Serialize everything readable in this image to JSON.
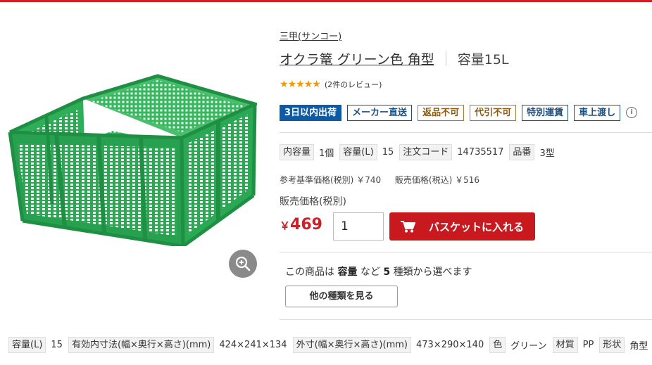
{
  "brand": "三甲(サンコー)",
  "title": "オクラ篭 グリーン色 角型",
  "capacity_heading": "容量15L",
  "rating": {
    "stars": 5,
    "review_text": "(2件のレビュー)"
  },
  "badges": [
    "3日以内出荷",
    "メーカー直送",
    "返品不可",
    "代引不可",
    "特別運賃",
    "車上渡し"
  ],
  "spec_main": [
    {
      "label": "内容量",
      "value": "1個"
    },
    {
      "label": "容量(L)",
      "value": "15"
    },
    {
      "label": "注文コード",
      "value": "14735517"
    },
    {
      "label": "品番",
      "value": "3型"
    }
  ],
  "price": {
    "reference": "参考基準価格(税別) ￥740",
    "incl_tax": "販売価格(税込) ￥516",
    "sale_label": "販売価格(税別)",
    "currency": "￥",
    "amount": "469",
    "quantity": "1",
    "cart_label": "バスケットに入れる"
  },
  "variants": {
    "prefix": "この商品は",
    "attribute": "容量",
    "middle": "など",
    "count": "5",
    "suffix": "種類から選べます",
    "button_label": "他の種類を見る"
  },
  "spec_bottom": [
    {
      "label": "容量(L)",
      "value": "15"
    },
    {
      "label": "有効内寸法(幅×奥行×高さ)(mm)",
      "value": "424×241×134"
    },
    {
      "label": "外寸(幅×奥行×高さ)(mm)",
      "value": "473×290×140"
    },
    {
      "label": "色",
      "value": "グリーン"
    },
    {
      "label": "材質",
      "value": "PP"
    },
    {
      "label": "形状",
      "value": "角型"
    }
  ],
  "colors": {
    "accent": "#cf1f26",
    "basket": "#2fae5a",
    "badge_blue": "#0d5aa7"
  },
  "icons": {
    "zoom": "zoom-in-icon",
    "cart": "cart-icon",
    "star": "star-icon"
  }
}
